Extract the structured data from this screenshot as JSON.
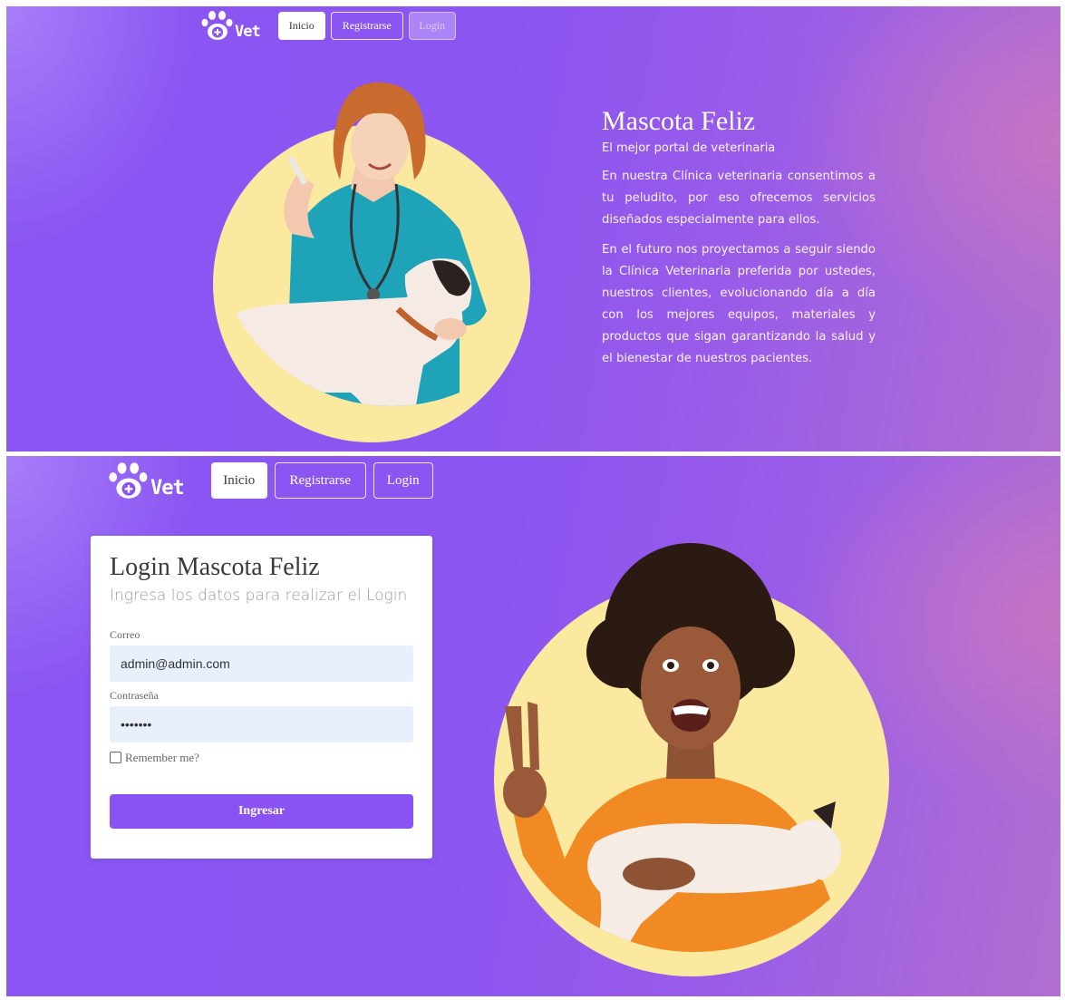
{
  "colors": {
    "accent": "#8a52f3",
    "hero_circle": "#fbe9a0",
    "input_bg": "#e8f0fe"
  },
  "screen_home": {
    "nav": {
      "logo_text": "Vet",
      "logo_icon": "paw-plus-icon",
      "items": [
        {
          "label": "Inicio",
          "state": "active"
        },
        {
          "label": "Registrarse",
          "state": "default"
        },
        {
          "label": "Login",
          "state": "dim"
        }
      ]
    },
    "hero": {
      "image": "veterinarian-with-dog-photo",
      "title": "Mascota Feliz",
      "subtitle": "El mejor portal de veterinaria",
      "paragraphs": [
        "En nuestra Clínica veterinaria consentimos a tu peludito, por eso ofrecemos servicios diseñados especialmente para ellos.",
        "En el futuro nos proyectamos a seguir siendo la Clínica Veterinaria preferida por ustedes, nuestros clientes, evolucionando día a día con los mejores equipos, materiales y productos que sigan garantizando la salud y el bienestar de nuestros pacientes."
      ]
    }
  },
  "screen_login": {
    "nav": {
      "logo_text": "Vet",
      "logo_icon": "paw-plus-icon",
      "items": [
        {
          "label": "Inicio",
          "state": "active"
        },
        {
          "label": "Registrarse",
          "state": "default"
        },
        {
          "label": "Login",
          "state": "default"
        }
      ]
    },
    "form": {
      "title": "Login Mascota Feliz",
      "subtitle": "Ingresa los datos para realizar el Login",
      "email_label": "Correo",
      "email_value": "admin@admin.com",
      "password_label": "Contraseña",
      "password_value": "•••••••",
      "remember_label": "Remember me?",
      "remember_checked": false,
      "submit_label": "Ingresar"
    },
    "hero": {
      "image": "woman-holding-puppy-photo"
    }
  }
}
